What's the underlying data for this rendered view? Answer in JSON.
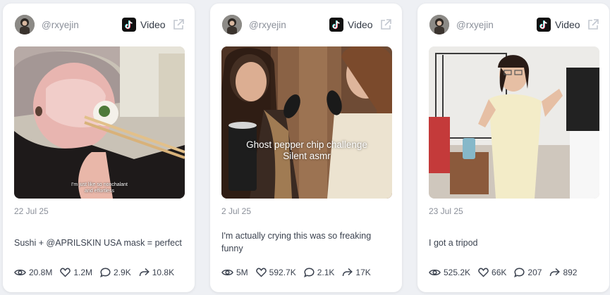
{
  "cards": [
    {
      "handle": "@rxyejin",
      "platform": "Video",
      "overlay_caption": "I'm just like so nonchalant\nand effortless",
      "date": "22 Jul 25",
      "description": "Sushi + @APRILSKIN USA mask = perfect",
      "stats": {
        "views": "20.8M",
        "likes": "1.2M",
        "comments": "2.9K",
        "shares": "10.8K"
      }
    },
    {
      "handle": "@rxyejin",
      "platform": "Video",
      "overlay_caption": "Ghost pepper chip challenge\nSilent asmr",
      "date": "2 Jul 25",
      "description": "I'm actually crying this was so freaking funny",
      "stats": {
        "views": "5M",
        "likes": "592.7K",
        "comments": "2.1K",
        "shares": "17K"
      }
    },
    {
      "handle": "@rxyejin",
      "platform": "Video",
      "date": "23 Jul 25",
      "description": "I got a tripod",
      "stats": {
        "views": "525.2K",
        "likes": "66K",
        "comments": "207",
        "shares": "892"
      }
    }
  ],
  "icons": {
    "platform": "tiktok-icon",
    "external": "external-link-icon",
    "views": "eye-icon",
    "likes": "heart-icon",
    "comments": "comment-icon",
    "shares": "share-icon"
  },
  "colors": {
    "page_background": "#eef0f4",
    "card_background": "#ffffff",
    "muted_text": "#8a8f99",
    "body_text": "#3c4350"
  }
}
